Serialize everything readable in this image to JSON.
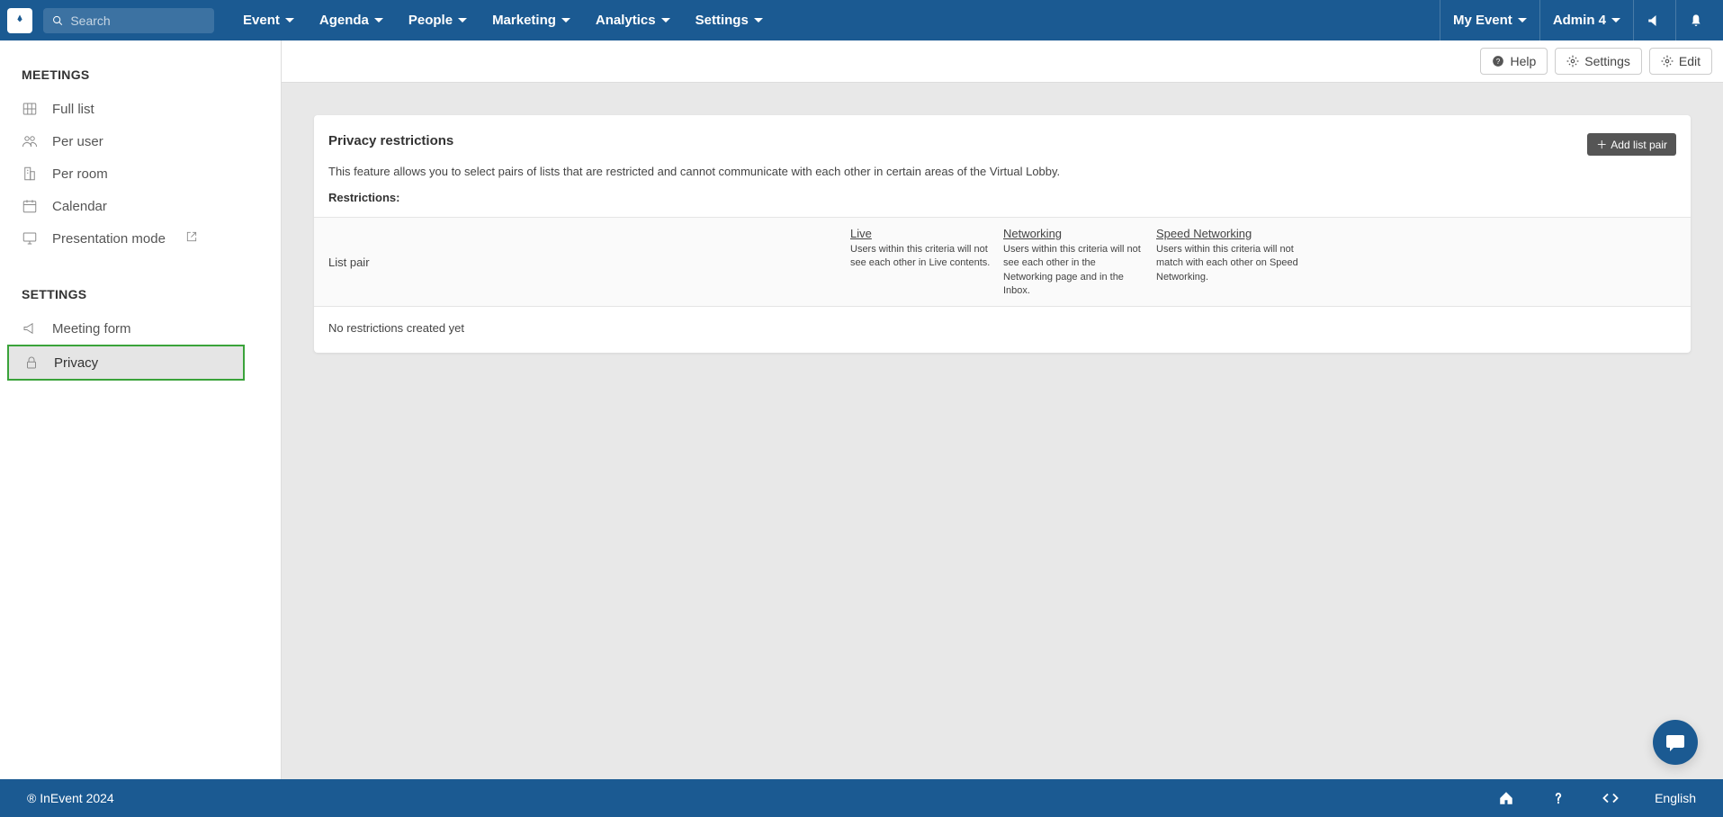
{
  "topnav": {
    "search_placeholder": "Search",
    "menu": [
      {
        "label": "Event"
      },
      {
        "label": "Agenda"
      },
      {
        "label": "People"
      },
      {
        "label": "Marketing"
      },
      {
        "label": "Analytics"
      },
      {
        "label": "Settings"
      }
    ],
    "my_event_label": "My Event",
    "admin_label": "Admin 4"
  },
  "sidebar": {
    "sections": [
      {
        "title": "MEETINGS",
        "items": [
          {
            "label": "Full list",
            "icon": "grid"
          },
          {
            "label": "Per user",
            "icon": "users"
          },
          {
            "label": "Per room",
            "icon": "building"
          },
          {
            "label": "Calendar",
            "icon": "calendar"
          },
          {
            "label": "Presentation mode",
            "icon": "monitor",
            "ext": true
          }
        ]
      },
      {
        "title": "SETTINGS",
        "items": [
          {
            "label": "Meeting form",
            "icon": "megaphone"
          },
          {
            "label": "Privacy",
            "icon": "lock",
            "active": true,
            "highlighted": true
          }
        ]
      }
    ]
  },
  "actionbar": {
    "help_label": "Help",
    "settings_label": "Settings",
    "edit_label": "Edit"
  },
  "panel": {
    "title": "Privacy restrictions",
    "desc": "This feature allows you to select pairs of lists that are restricted and cannot communicate with each other in certain areas of the Virtual Lobby.",
    "subtitle": "Restrictions:",
    "add_btn_label": "Add list pair",
    "columns": {
      "list_pair": "List pair",
      "live": {
        "title": "Live",
        "desc": "Users within this criteria will not see each other in Live contents."
      },
      "networking": {
        "title": "Networking",
        "desc": "Users within this criteria will not see each other in the Networking page and in the Inbox."
      },
      "speed": {
        "title": "Speed Networking",
        "desc": "Users within this criteria will not match with each other on Speed Networking."
      }
    },
    "empty_text": "No restrictions created yet"
  },
  "footer": {
    "copyright": "® InEvent 2024",
    "language": "English"
  }
}
